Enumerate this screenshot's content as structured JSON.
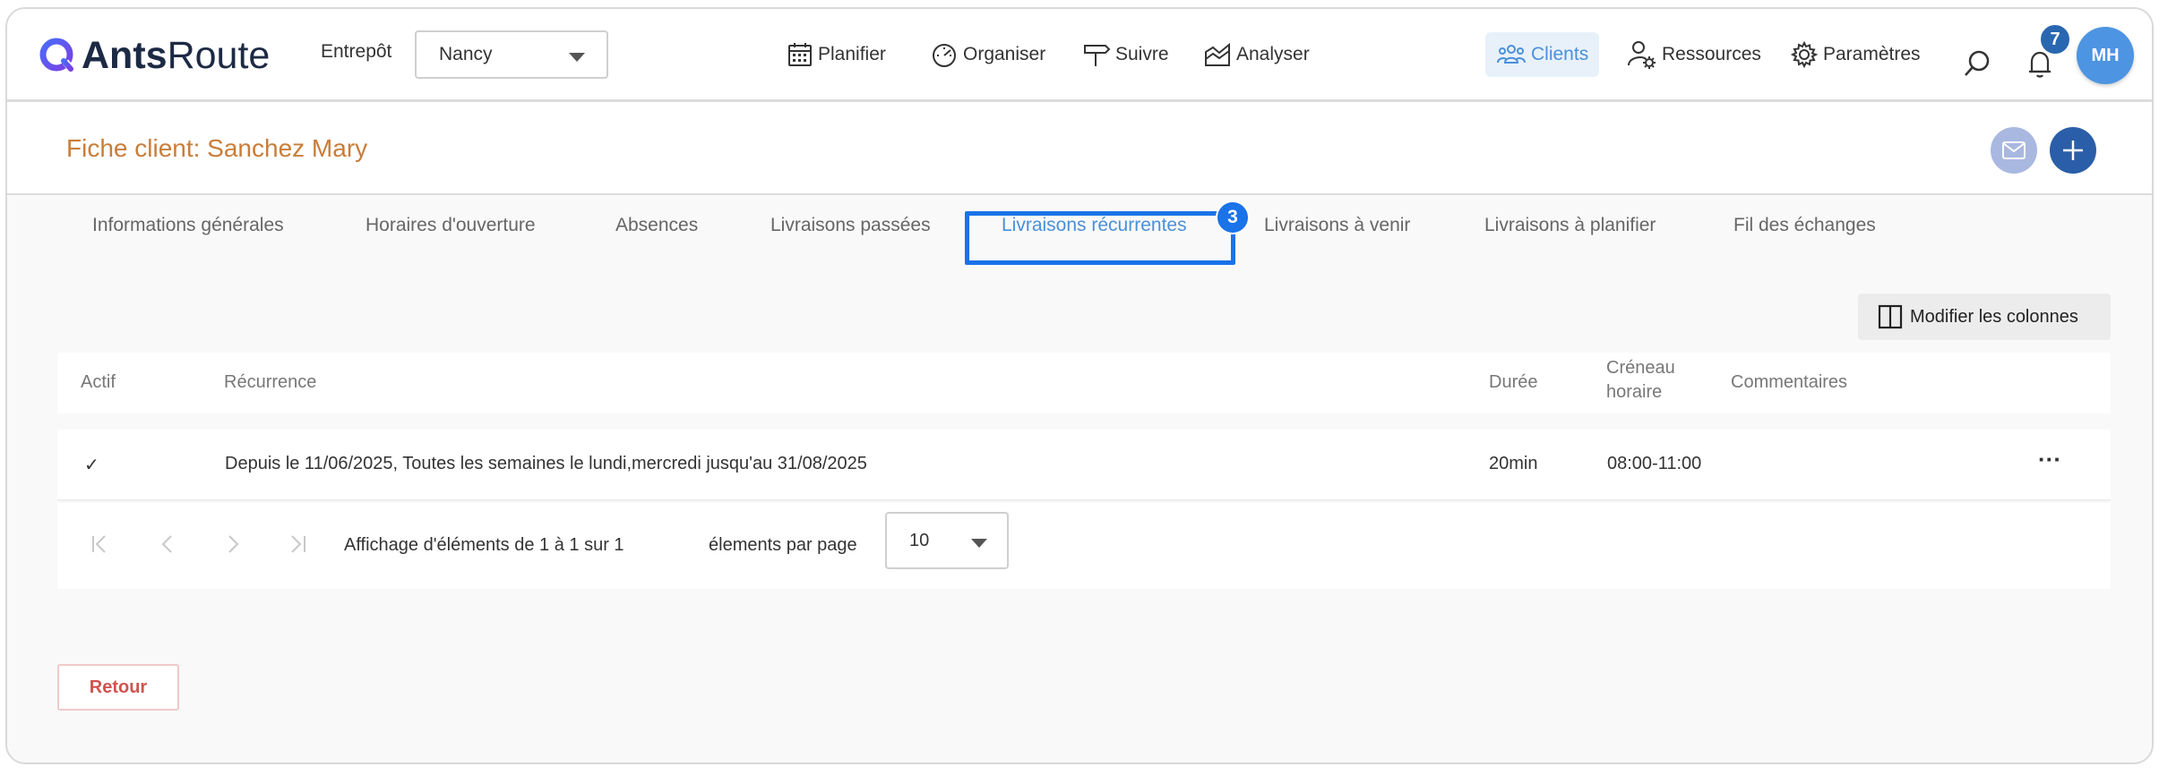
{
  "brand": {
    "bold": "Ants",
    "light": "Route"
  },
  "header": {
    "warehouse_label": "Entrepôt",
    "warehouse_value": "Nancy",
    "nav": {
      "planifier": "Planifier",
      "organiser": "Organiser",
      "suivre": "Suivre",
      "analyser": "Analyser",
      "clients": "Clients",
      "ressources": "Ressources",
      "parametres": "Paramètres"
    },
    "notification_count": "7",
    "avatar_initials": "MH"
  },
  "page": {
    "title": "Fiche client: Sanchez Mary"
  },
  "tabs": [
    {
      "label": "Informations générales"
    },
    {
      "label": "Horaires d'ouverture"
    },
    {
      "label": "Absences"
    },
    {
      "label": "Livraisons passées"
    },
    {
      "label": "Livraisons récurrentes"
    },
    {
      "label": "Livraisons à venir"
    },
    {
      "label": "Livraisons à planifier"
    },
    {
      "label": "Fil des échanges"
    }
  ],
  "active_tab_marker": "3",
  "toolbar": {
    "columns_label": "Modifier les colonnes"
  },
  "table": {
    "headers": {
      "actif": "Actif",
      "recurrence": "Récurrence",
      "duree": "Durée",
      "creneau_line1": "Créneau",
      "creneau_line2": "horaire",
      "commentaires": "Commentaires"
    },
    "rows": [
      {
        "actif": "✓",
        "recurrence": "Depuis le 11/06/2025, Toutes les semaines le lundi,mercredi jusqu'au 31/08/2025",
        "duree": "20min",
        "creneau": "08:00-11:00",
        "commentaires": "",
        "actions": "···"
      }
    ]
  },
  "pagination": {
    "summary": "Affichage d'éléments de 1 à 1 sur 1",
    "per_page_label": "élements par page",
    "per_page_value": "10"
  },
  "footer": {
    "back_label": "Retour"
  },
  "colors": {
    "accent": "#4a90d9",
    "title": "#c97d3a",
    "highlight": "#1a73e8",
    "primary_button": "#2a5ea8",
    "danger": "#d0534f"
  }
}
